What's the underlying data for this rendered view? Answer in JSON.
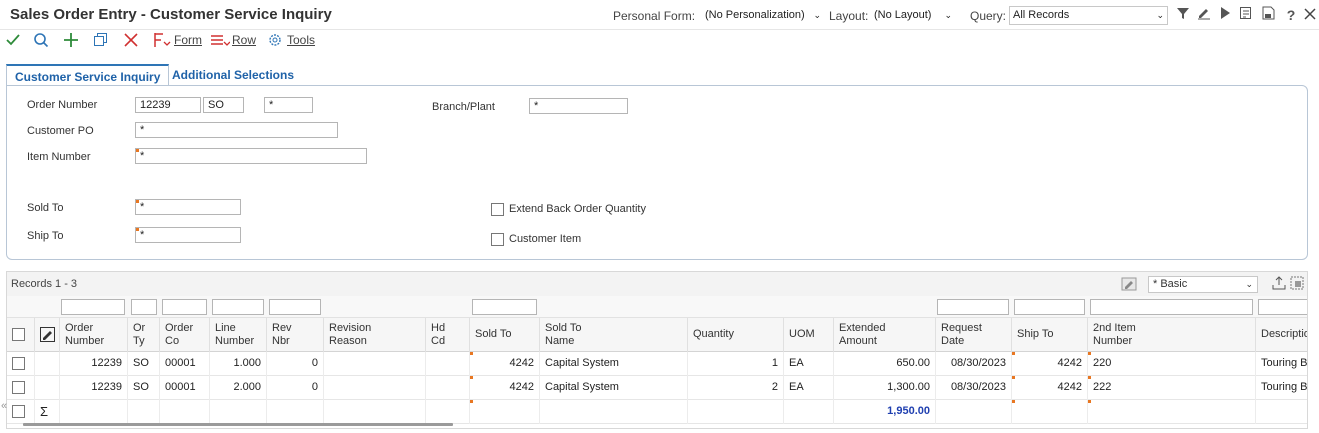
{
  "app": {
    "title": "Sales Order Entry - Customer Service Inquiry",
    "personal_form_label": "Personal Form:",
    "personal_form_value": "(No Personalization)",
    "layout_label": "Layout:",
    "layout_value": "(No Layout)",
    "query_label": "Query:",
    "query_value": "All Records"
  },
  "toolbar": {
    "form_label": "Form",
    "row_label": "Row",
    "tools_label": "Tools"
  },
  "tabs": [
    {
      "label": "Customer Service Inquiry",
      "active": true
    },
    {
      "label": "Additional Selections",
      "active": false
    }
  ],
  "form": {
    "order_number_label": "Order Number",
    "order_number": "12239",
    "order_type": "SO",
    "order_company": "*",
    "branch_plant_label": "Branch/Plant",
    "branch_plant": "*",
    "customer_po_label": "Customer PO",
    "customer_po": "*",
    "item_number_label": "Item Number",
    "item_number": "*",
    "sold_to_label": "Sold To",
    "sold_to": "*",
    "ship_to_label": "Ship To",
    "ship_to": "*",
    "extend_backorder_label": "Extend Back Order Quantity",
    "customer_item_label": "Customer Item"
  },
  "grid": {
    "records_label": "Records 1 - 3",
    "view_value": "* Basic",
    "headers": {
      "order_number": [
        "Order",
        "Number"
      ],
      "or_ty": [
        "Or",
        "Ty"
      ],
      "order_co": [
        "Order",
        "Co"
      ],
      "line_number": [
        "Line",
        "Number"
      ],
      "rev_nbr": [
        "Rev",
        "Nbr"
      ],
      "revision_reason": [
        "Revision",
        "Reason"
      ],
      "hd_cd": [
        "Hd",
        "Cd"
      ],
      "sold_to": "Sold To",
      "sold_to_name": [
        "Sold To",
        "Name"
      ],
      "quantity": "Quantity",
      "uom": "UOM",
      "extended_amount": [
        "Extended",
        "Amount"
      ],
      "request_date": [
        "Request",
        "Date"
      ],
      "ship_to": "Ship To",
      "second_item": [
        "2nd Item",
        "Number"
      ],
      "description": "Descriptio"
    },
    "rows": [
      {
        "order_number": "12239",
        "or_ty": "SO",
        "order_co": "00001",
        "line_number": "1.000",
        "rev_nbr": "0",
        "sold_to": "4242",
        "sold_to_name": "Capital System",
        "quantity": "1",
        "uom": "EA",
        "extended_amount": "650.00",
        "request_date": "08/30/2023",
        "ship_to": "4242",
        "second_item": "220",
        "description": "Touring Bik"
      },
      {
        "order_number": "12239",
        "or_ty": "SO",
        "order_co": "00001",
        "line_number": "2.000",
        "rev_nbr": "0",
        "sold_to": "4242",
        "sold_to_name": "Capital System",
        "quantity": "2",
        "uom": "EA",
        "extended_amount": "1,300.00",
        "request_date": "08/30/2023",
        "ship_to": "4242",
        "second_item": "222",
        "description": "Touring Bik"
      }
    ],
    "total_symbol": "Σ",
    "total_amount": "1,950.00"
  }
}
